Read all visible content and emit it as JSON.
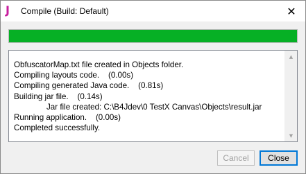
{
  "window": {
    "title": "Compile (Build: Default)",
    "app_icon_glyph": "J",
    "app_icon_color": "#c81e9e",
    "close_glyph": "✕"
  },
  "progress": {
    "value_percent": 100,
    "color": "#06b025"
  },
  "log": {
    "lines": [
      {
        "text": "ObfuscatorMap.txt file created in Objects folder.",
        "indent": false
      },
      {
        "text": "Compiling layouts code.    (0.00s)",
        "indent": false
      },
      {
        "text": "Compiling generated Java code.    (0.81s)",
        "indent": false
      },
      {
        "text": "Building jar file.    (0.14s)",
        "indent": false
      },
      {
        "text": "Jar file created: C:\\B4Jdev\\0 TestX Canvas\\Objects\\result.jar",
        "indent": true
      },
      {
        "text": "Running application.    (0.00s)",
        "indent": false
      },
      {
        "text": "Completed successfully.",
        "indent": false
      }
    ]
  },
  "scrollbar": {
    "up_glyph": "▲",
    "down_glyph": "▼"
  },
  "buttons": {
    "cancel_label": "Cancel",
    "close_label": "Close"
  }
}
